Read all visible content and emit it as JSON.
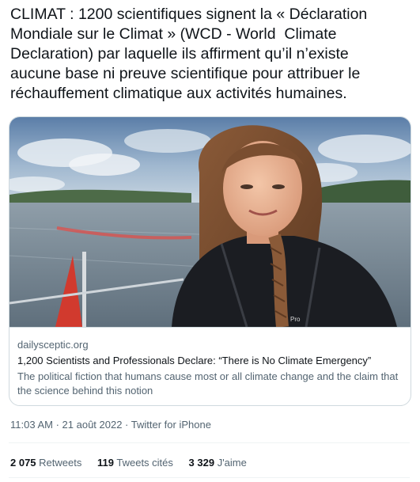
{
  "tweet": {
    "text": "CLIMAT : 1200 scientifiques signent la « Déclaration\nMondiale sur le Climat » (WCD - World  Climate\nDeclaration) par laquelle ils affirment qu’il n’existe\naucune base ni preuve scientifique pour attribuer le\nréchauffement climatique aux activités humaines."
  },
  "card": {
    "domain": "dailysceptic.org",
    "title": "1,200 Scientists and Professionals Declare: “There is No Climate Emergency”",
    "description": "The political fiction that humans cause most or all climate change and the claim that the science behind this notion",
    "jacket_brand": "Pro"
  },
  "meta": {
    "time": "11:03 AM",
    "separator": " · ",
    "date": "21 août 2022",
    "source": "Twitter for iPhone"
  },
  "stats": {
    "retweets_count": "2 075",
    "retweets_label": "Retweets",
    "quotes_count": "119",
    "quotes_label": "Tweets cités",
    "likes_count": "3 329",
    "likes_label": "J'aime"
  },
  "colors": {
    "text": "#0f1419",
    "secondary": "#536471",
    "border": "#cfd9de"
  }
}
